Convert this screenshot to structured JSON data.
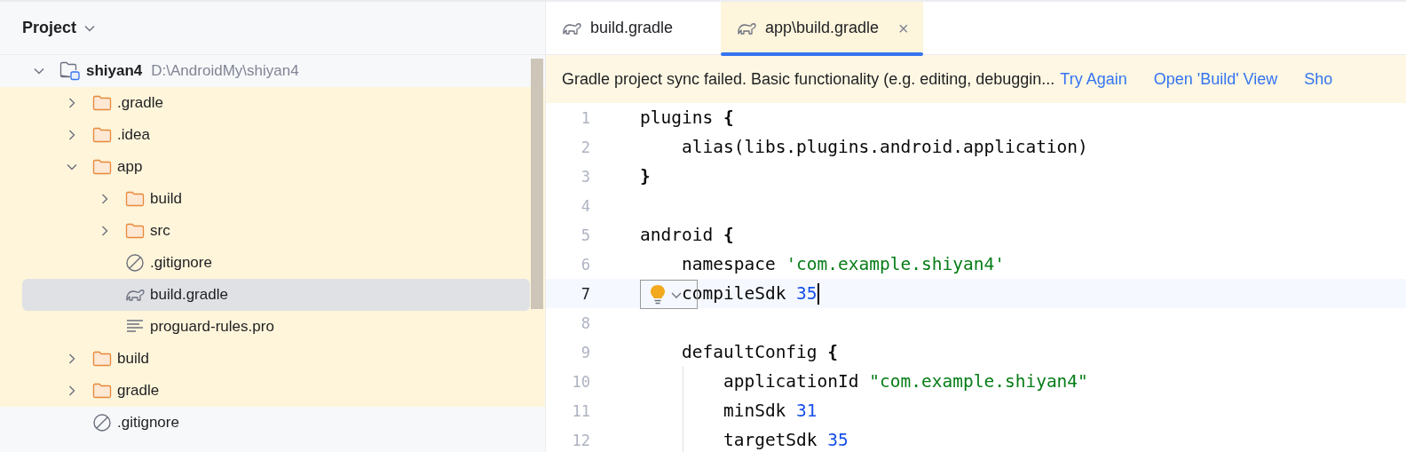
{
  "project_panel": {
    "title": "Project",
    "tree": [
      {
        "label": "shiyan4",
        "path": "D:\\AndroidMy\\shiyan4",
        "kind": "module",
        "expanded": true,
        "highlighted": false,
        "selected": false,
        "children": [
          {
            "label": ".gradle",
            "kind": "folder",
            "expanded": false,
            "highlighted": true,
            "selected": false
          },
          {
            "label": ".idea",
            "kind": "folder",
            "expanded": false,
            "highlighted": true,
            "selected": false
          },
          {
            "label": "app",
            "kind": "folder",
            "expanded": true,
            "highlighted": true,
            "selected": false,
            "children": [
              {
                "label": "build",
                "kind": "folder",
                "expanded": false,
                "highlighted": true,
                "selected": false
              },
              {
                "label": "src",
                "kind": "folder",
                "expanded": false,
                "highlighted": true,
                "selected": false
              },
              {
                "label": ".gitignore",
                "kind": "gitignore",
                "highlighted": true,
                "selected": false
              },
              {
                "label": "build.gradle",
                "kind": "gradle",
                "highlighted": true,
                "selected": true
              },
              {
                "label": "proguard-rules.pro",
                "kind": "text",
                "highlighted": true,
                "selected": false
              }
            ]
          },
          {
            "label": "build",
            "kind": "folder",
            "expanded": false,
            "highlighted": true,
            "selected": false
          },
          {
            "label": "gradle",
            "kind": "folder",
            "expanded": false,
            "highlighted": true,
            "selected": false
          },
          {
            "label": ".gitignore",
            "kind": "gitignore",
            "highlighted": false,
            "selected": false
          }
        ]
      }
    ]
  },
  "tabs": [
    {
      "label": "build.gradle",
      "selected": false
    },
    {
      "label": "app\\build.gradle",
      "selected": true
    }
  ],
  "close_glyph": "×",
  "banner": {
    "message": "Gradle project sync failed. Basic functionality (e.g. editing, debuggin...",
    "links": [
      "Try Again",
      "Open 'Build' View",
      "Sho"
    ]
  },
  "editor": {
    "lines": [
      {
        "number": "1",
        "current": false,
        "tokens": [
          {
            "text": "plugins ",
            "kind": "plain"
          },
          {
            "text": "{",
            "kind": "brace"
          }
        ]
      },
      {
        "number": "2",
        "current": false,
        "tokens": [
          {
            "text": "    alias(libs.plugins.android.application)",
            "kind": "plain"
          }
        ]
      },
      {
        "number": "3",
        "current": false,
        "tokens": [
          {
            "text": "}",
            "kind": "brace"
          }
        ]
      },
      {
        "number": "4",
        "current": false
      },
      {
        "number": "5",
        "current": false,
        "tokens": [
          {
            "text": "android ",
            "kind": "plain"
          },
          {
            "text": "{",
            "kind": "brace"
          }
        ]
      },
      {
        "number": "6",
        "current": false,
        "tokens": [
          {
            "text": "    namespace ",
            "kind": "plain"
          },
          {
            "text": "'com.example.shiyan4'",
            "kind": "string"
          }
        ]
      },
      {
        "number": "7",
        "current": true,
        "tokens": [
          {
            "text": "    compileSdk ",
            "kind": "plain"
          },
          {
            "text": "35",
            "kind": "number"
          }
        ]
      },
      {
        "number": "8",
        "current": false
      },
      {
        "number": "9",
        "current": false,
        "tokens": [
          {
            "text": "    defaultConfig ",
            "kind": "plain"
          },
          {
            "text": "{",
            "kind": "brace"
          }
        ]
      },
      {
        "number": "10",
        "current": false,
        "tokens": [
          {
            "text": "        applicationId ",
            "kind": "plain"
          },
          {
            "text": "\"com.example.shiyan4\"",
            "kind": "string"
          }
        ]
      },
      {
        "number": "11",
        "current": false,
        "tokens": [
          {
            "text": "        minSdk ",
            "kind": "plain"
          },
          {
            "text": "31",
            "kind": "number"
          }
        ]
      },
      {
        "number": "12",
        "current": false,
        "tokens": [
          {
            "text": "        targetSdk ",
            "kind": "plain"
          },
          {
            "text": "35",
            "kind": "number"
          }
        ]
      }
    ]
  }
}
